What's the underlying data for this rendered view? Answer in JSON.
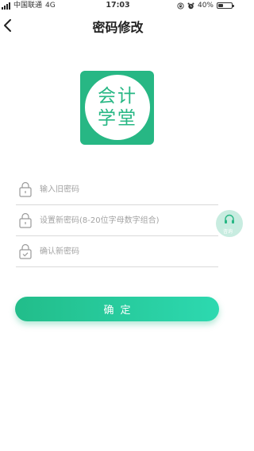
{
  "status_bar": {
    "carrier": "中国联通",
    "network": "4G",
    "time": "17:03",
    "battery_percent": "40%",
    "battery_level": 0.4,
    "icons": [
      "signal-icon",
      "lock-rotation-icon",
      "alarm-icon",
      "battery-icon"
    ]
  },
  "header": {
    "title": "密码修改",
    "back_icon": "chevron-left-icon"
  },
  "logo": {
    "line1": "会计",
    "line2": "学堂",
    "color": "#27b784"
  },
  "form": {
    "old_password": {
      "placeholder": "输入旧密码",
      "value": "",
      "icon": "lock-icon"
    },
    "new_password": {
      "placeholder": "设置新密码(8-20位字母数字组合)",
      "value": "",
      "icon": "lock-icon"
    },
    "confirm_password": {
      "placeholder": "确认新密码",
      "value": "",
      "icon": "lock-check-icon"
    }
  },
  "consult": {
    "label": "咨询",
    "icon": "headset-icon"
  },
  "submit": {
    "label": "确定"
  },
  "colors": {
    "accent": "#27b784",
    "accent_light": "#2dd9b0"
  }
}
